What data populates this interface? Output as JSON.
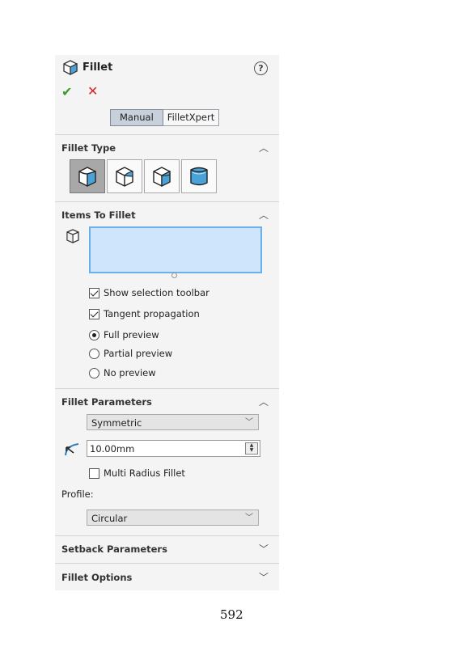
{
  "panel": {
    "title": "Fillet",
    "help_label": "?",
    "ok_symbol": "✔",
    "cancel_symbol": "✕",
    "tabs": [
      {
        "label": "Manual",
        "active": true
      },
      {
        "label": "FilletXpert",
        "active": false
      }
    ]
  },
  "fillet_type": {
    "title": "Fillet Type",
    "types": [
      "constant-size-fillet-icon",
      "variable-size-fillet-icon",
      "face-fillet-icon",
      "full-round-fillet-icon"
    ]
  },
  "items_to_fillet": {
    "title": "Items To Fillet",
    "options": {
      "show_selection_toolbar": {
        "label": "Show selection toolbar",
        "checked": true
      },
      "tangent_propagation": {
        "label": "Tangent propagation",
        "checked": true
      },
      "full_preview": {
        "label": "Full preview",
        "selected": true
      },
      "partial_preview": {
        "label": "Partial preview",
        "selected": false
      },
      "no_preview": {
        "label": "No preview",
        "selected": false
      }
    }
  },
  "fillet_parameters": {
    "title": "Fillet Parameters",
    "method": "Symmetric",
    "radius": "10.00mm",
    "multi_radius": {
      "label": "Multi Radius Fillet",
      "checked": false
    },
    "profile_label": "Profile:",
    "profile": "Circular"
  },
  "setback_parameters": {
    "title": "Setback Parameters"
  },
  "fillet_options": {
    "title": "Fillet Options"
  },
  "colors": {
    "accent_check": "#3a9a2a",
    "accent_cancel": "#dd2222",
    "selection_fill": "#cfe5fb",
    "selection_border": "#6ab0ea",
    "icon_blue": "#4aa3d8"
  },
  "page_number": "592"
}
